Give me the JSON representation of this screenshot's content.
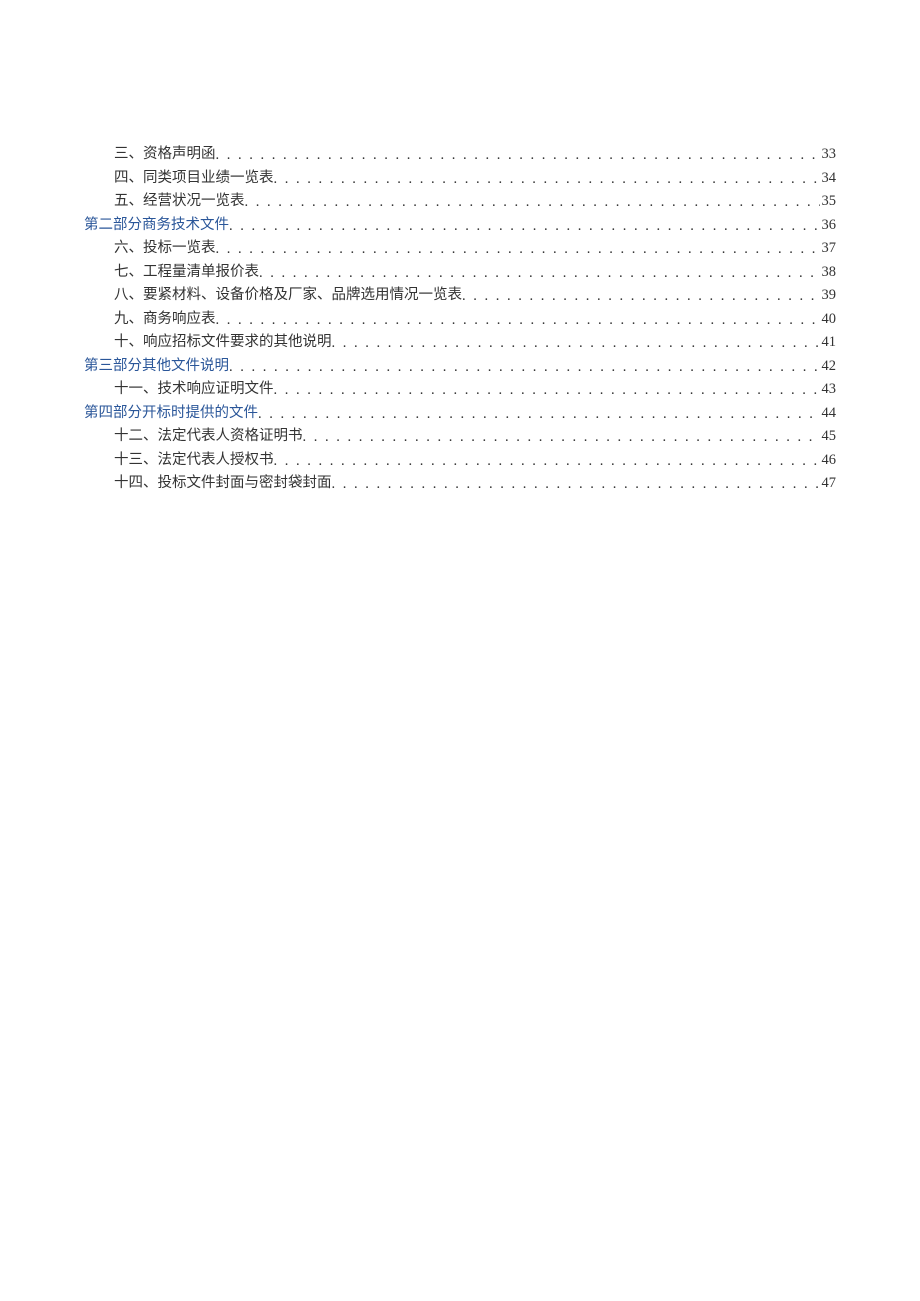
{
  "toc": [
    {
      "label": "三、资格声明函",
      "page": "33",
      "indent": 1,
      "link": false
    },
    {
      "label": "四、同类项目业绩一览表",
      "page": "34",
      "indent": 1,
      "link": false
    },
    {
      "label": "五、经营状况一览表",
      "page": "35",
      "indent": 1,
      "link": false
    },
    {
      "label": "第二部分商务技术文件",
      "page": "36",
      "indent": 0,
      "link": true
    },
    {
      "label": "六、投标一览表",
      "page": "37",
      "indent": 1,
      "link": false
    },
    {
      "label": "七、工程量清单报价表",
      "page": "38",
      "indent": 1,
      "link": false
    },
    {
      "label": "八、要紧材料、设备价格及厂家、品牌选用情况一览表",
      "page": "39",
      "indent": 1,
      "link": false
    },
    {
      "label": "九、商务响应表",
      "page": "40",
      "indent": 1,
      "link": false
    },
    {
      "label": "十、响应招标文件要求的其他说明",
      "page": "41",
      "indent": 1,
      "link": false
    },
    {
      "label": "第三部分其他文件说明",
      "page": "42",
      "indent": 0,
      "link": true
    },
    {
      "label": "十一、技术响应证明文件",
      "page": "43",
      "indent": 1,
      "link": false
    },
    {
      "label": "第四部分开标时提供的文件",
      "page": "44",
      "indent": 0,
      "link": true
    },
    {
      "label": "十二、法定代表人资格证明书",
      "page": "45",
      "indent": 1,
      "link": false
    },
    {
      "label": "十三、法定代表人授权书",
      "page": "46",
      "indent": 1,
      "link": false
    },
    {
      "label": "十四、投标文件封面与密封袋封面",
      "page": "47",
      "indent": 1,
      "link": false
    }
  ]
}
